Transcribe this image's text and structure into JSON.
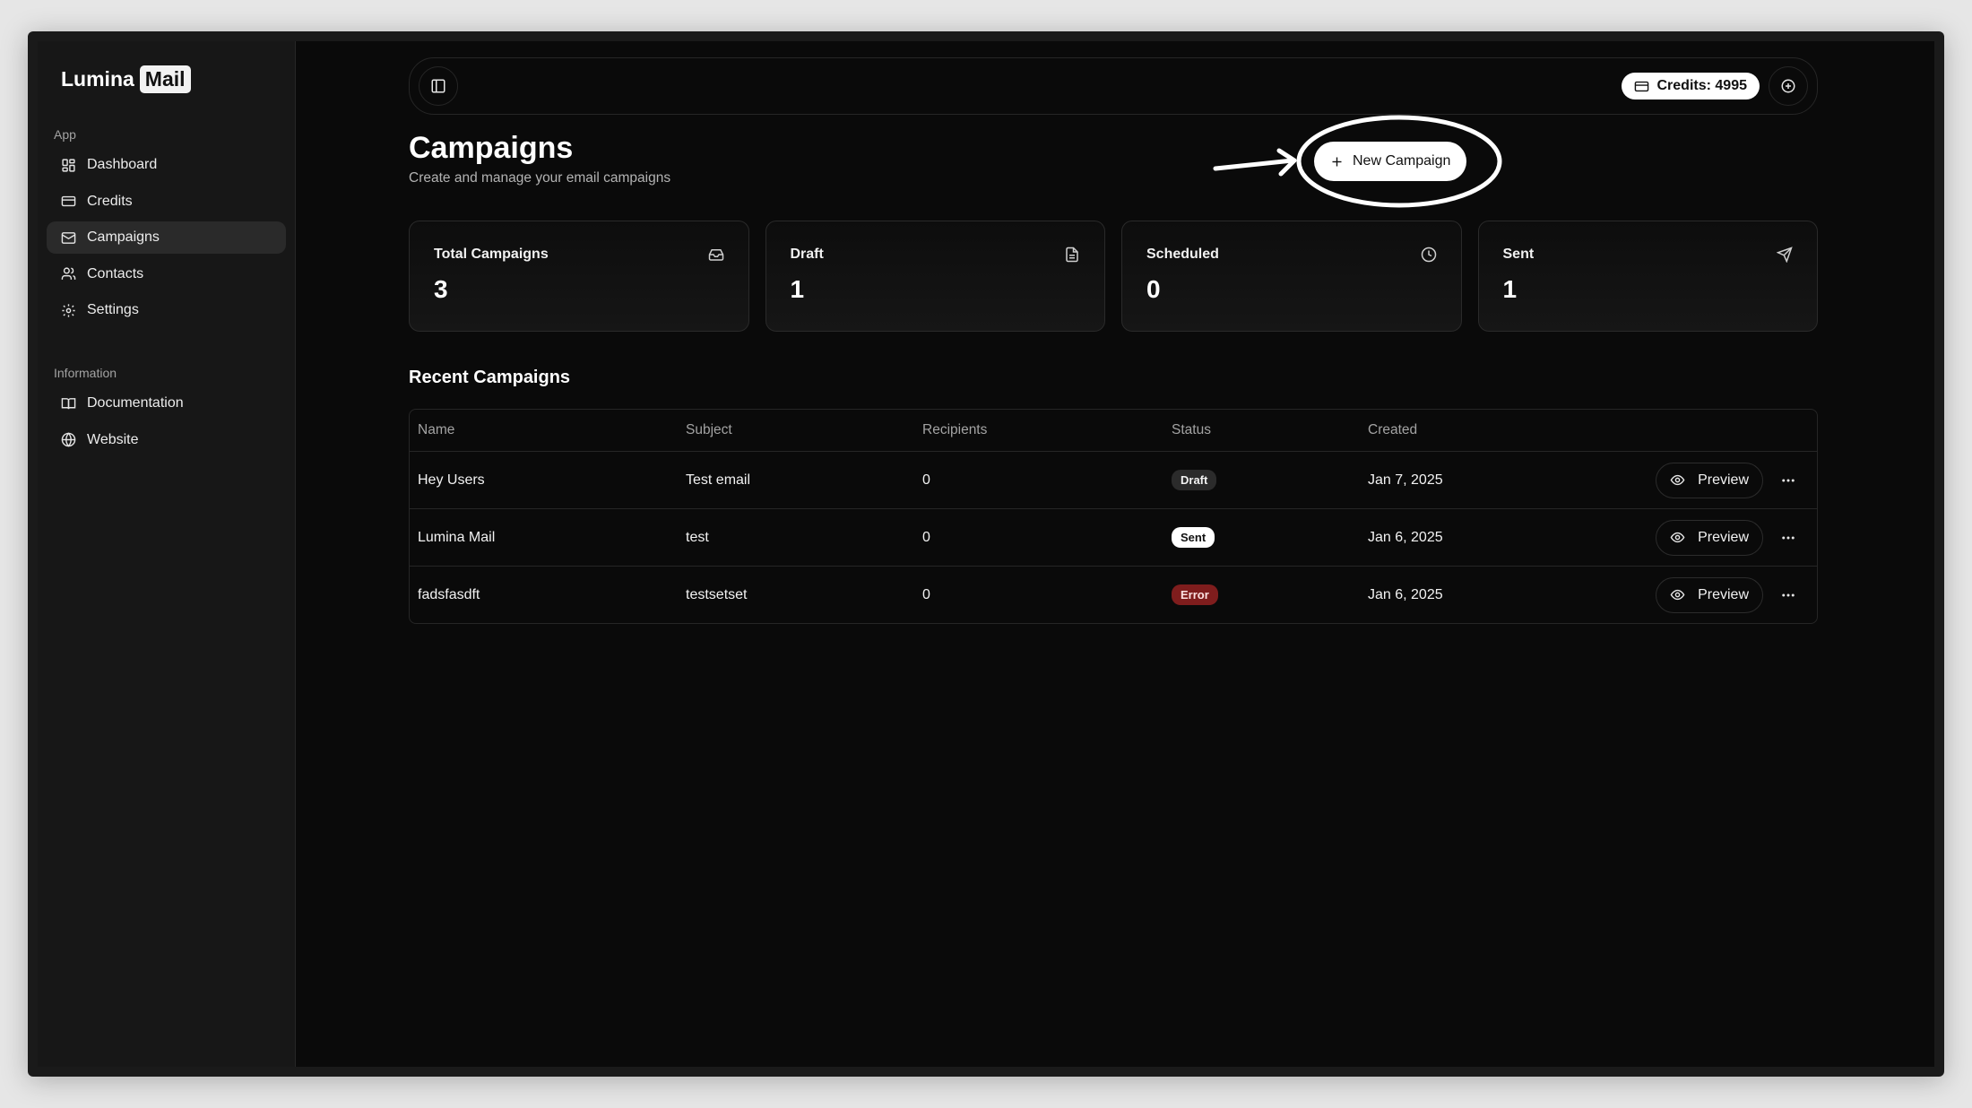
{
  "brand": {
    "name": "Lumina",
    "suffix": "Mail"
  },
  "sidebar": {
    "groups": [
      {
        "label": "App",
        "items": [
          {
            "label": "Dashboard",
            "icon": "grid-icon"
          },
          {
            "label": "Credits",
            "icon": "credit-card-icon"
          },
          {
            "label": "Campaigns",
            "icon": "mail-icon",
            "active": true
          },
          {
            "label": "Contacts",
            "icon": "users-icon"
          },
          {
            "label": "Settings",
            "icon": "gear-icon"
          }
        ]
      },
      {
        "label": "Information",
        "items": [
          {
            "label": "Documentation",
            "icon": "book-icon"
          },
          {
            "label": "Website",
            "icon": "globe-icon"
          }
        ]
      }
    ]
  },
  "topbar": {
    "credits_label": "Credits: 4995"
  },
  "page": {
    "title": "Campaigns",
    "subtitle": "Create and manage your email campaigns",
    "new_button": "New Campaign"
  },
  "stats": [
    {
      "label": "Total Campaigns",
      "value": "3",
      "icon": "inbox-icon"
    },
    {
      "label": "Draft",
      "value": "1",
      "icon": "file-icon"
    },
    {
      "label": "Scheduled",
      "value": "0",
      "icon": "clock-icon"
    },
    {
      "label": "Sent",
      "value": "1",
      "icon": "send-icon"
    }
  ],
  "recent": {
    "title": "Recent Campaigns",
    "columns": [
      "Name",
      "Subject",
      "Recipients",
      "Status",
      "Created"
    ],
    "rows": [
      {
        "name": "Hey Users",
        "subject": "Test email",
        "recipients": "0",
        "status": "Draft",
        "created": "Jan 7, 2025",
        "action": "Preview"
      },
      {
        "name": "Lumina Mail",
        "subject": "test",
        "recipients": "0",
        "status": "Sent",
        "created": "Jan 6, 2025",
        "action": "Preview"
      },
      {
        "name": "fadsfasdft",
        "subject": "testsetset",
        "recipients": "0",
        "status": "Error",
        "created": "Jan 6, 2025",
        "action": "Preview"
      }
    ]
  },
  "colors": {
    "background": "#0a0a0a",
    "sidebar": "#171717",
    "error_badge": "#7f1d1d",
    "accent": "#ffffff"
  }
}
